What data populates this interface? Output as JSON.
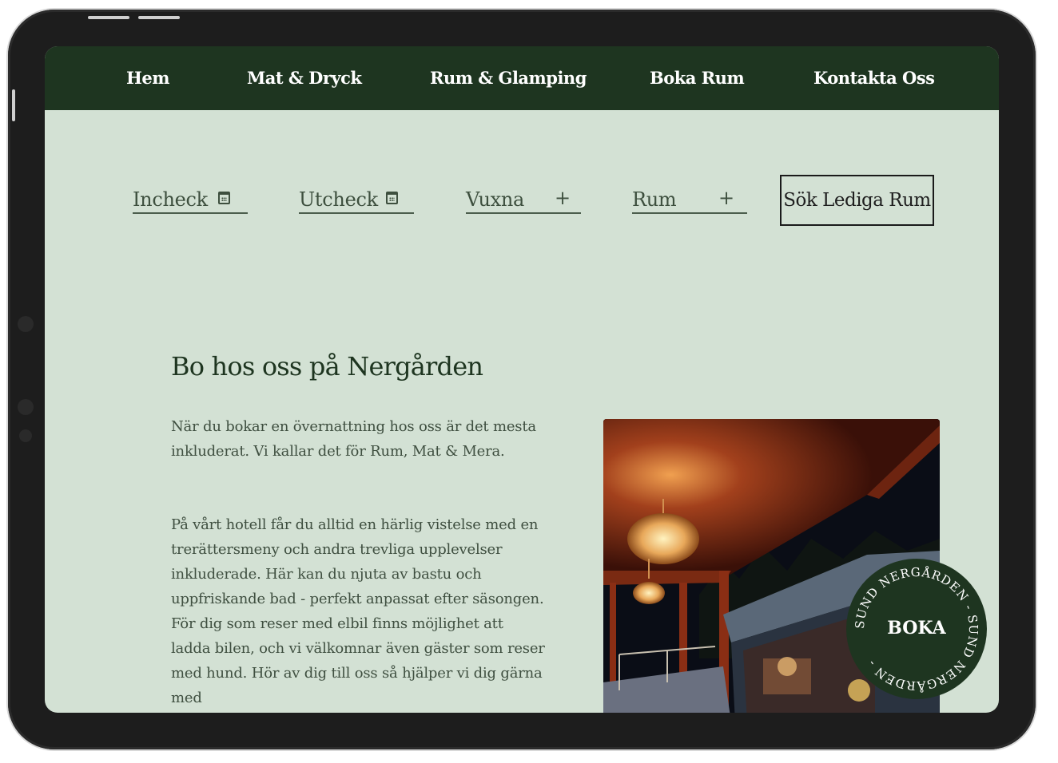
{
  "nav": {
    "items": [
      "Hem",
      "Mat & Dryck",
      "Rum & Glamping",
      "Boka Rum",
      "Kontakta Oss"
    ]
  },
  "booking": {
    "checkin_label": "Incheck",
    "checkout_label": "Utcheck",
    "adults_label": "Vuxna",
    "rooms_label": "Rum",
    "plus_symbol": "+",
    "search_button": "Sök Lediga Rum"
  },
  "content": {
    "heading": "Bo hos oss på Nergården",
    "paragraph1": "När du bokar en övernattning hos oss är det mesta inkluderat. Vi kallar det för Rum, Mat & Mera.",
    "paragraph2": "På vårt hotell får du alltid en härlig vistelse med en trerättersmeny och andra trevliga upplevelser inkluderade. Här kan du njuta av bastu och uppfriskande bad - perfekt anpassat efter säsongen. För dig som reser med elbil finns möjlighet att ladda bilen, och vi välkomnar även gäster som reser med hund. Hör av dig till oss så hjälper vi dig gärna med"
  },
  "badge": {
    "label": "BOKA",
    "ring_text": "SUND NERGÅRDEN - SUND NERGÅRDEN -"
  },
  "colors": {
    "nav_bg": "#1e3520",
    "page_bg": "#d3e1d4",
    "text": "#3f4f40",
    "heading": "#1e3520"
  }
}
